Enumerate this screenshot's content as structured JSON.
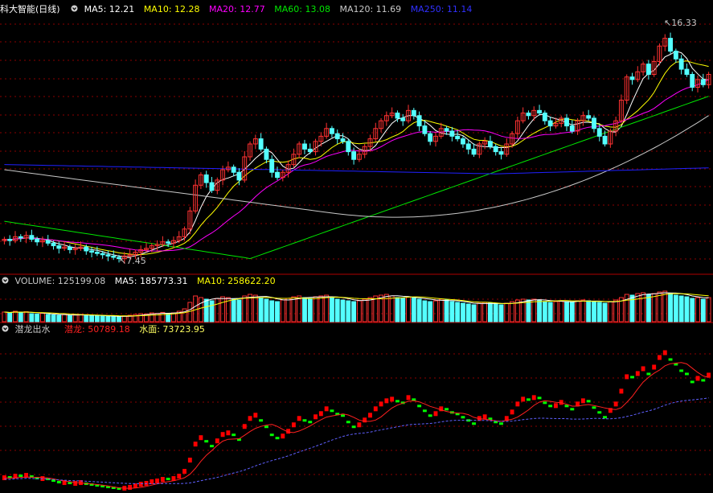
{
  "colors": {
    "up": "#ff3232",
    "down": "#54ffff",
    "grid": "#8b0000",
    "sep": "#b00000",
    "ma5": "#ffffff",
    "ma10": "#ffff00",
    "ma20": "#ff00ff",
    "ma60": "#00e600",
    "ma120": "#c8c8c8",
    "ma250": "#2020ff",
    "qianlong_up": "#ff0000",
    "qianlong_down": "#00ff00",
    "qianlong_line": "#ff2020",
    "shuimian": "#6060ff"
  },
  "price_panel": {
    "title": "科大智能(日线)",
    "ma_labels": [
      {
        "text": "MA5: 12.21",
        "color": "#ffffff"
      },
      {
        "text": "MA10: 12.28",
        "color": "#ffff00"
      },
      {
        "text": "MA20: 12.77",
        "color": "#ff00ff"
      },
      {
        "text": "MA60: 13.08",
        "color": "#00e600"
      },
      {
        "text": "MA120: 11.69",
        "color": "#c8c8c8"
      },
      {
        "text": "MA250: 11.14",
        "color": "#2020ff"
      }
    ],
    "high_label": "16.33",
    "low_label": "7.45"
  },
  "volume_panel": {
    "labels": [
      {
        "text": "VOLUME: 125199.08",
        "color": "#c8c8c8"
      },
      {
        "text": "MA5: 185773.31",
        "color": "#ffffff"
      },
      {
        "text": "MA10: 258622.20",
        "color": "#ffff00"
      }
    ]
  },
  "indicator_panel": {
    "title": "潜龙出水",
    "labels": [
      {
        "text": "潜龙: 50789.18",
        "color": "#ff2020"
      },
      {
        "text": "水面: 73723.95",
        "color": "#ffff60"
      }
    ]
  },
  "chart_data": {
    "type": "candlestick",
    "closes": [
      8.2,
      8.15,
      8.3,
      8.25,
      8.35,
      8.2,
      8.1,
      8.15,
      8.05,
      7.95,
      7.85,
      7.9,
      7.8,
      7.85,
      7.9,
      7.75,
      7.7,
      7.65,
      7.6,
      7.55,
      7.5,
      7.45,
      7.55,
      7.6,
      7.7,
      7.8,
      7.85,
      7.95,
      8.0,
      8.1,
      8.05,
      8.15,
      8.3,
      8.6,
      9.3,
      10.3,
      10.7,
      10.4,
      10.1,
      10.5,
      10.9,
      11.0,
      10.8,
      10.5,
      11.4,
      11.9,
      12.1,
      11.7,
      11.3,
      10.8,
      10.6,
      10.8,
      11.1,
      11.5,
      11.9,
      11.7,
      11.6,
      12.0,
      12.2,
      12.5,
      12.3,
      12.1,
      12.0,
      11.6,
      11.3,
      11.5,
      11.8,
      12.1,
      12.5,
      12.8,
      13.0,
      13.1,
      12.9,
      12.8,
      13.2,
      13.0,
      12.6,
      12.3,
      12.0,
      12.2,
      12.5,
      12.4,
      12.2,
      12.1,
      11.9,
      11.7,
      11.5,
      11.9,
      12.0,
      11.8,
      11.6,
      11.5,
      11.9,
      12.3,
      12.8,
      13.1,
      13.0,
      13.2,
      13.1,
      12.8,
      12.6,
      12.7,
      12.9,
      12.6,
      12.4,
      12.8,
      13.0,
      12.9,
      12.5,
      12.2,
      11.9,
      12.4,
      12.8,
      13.6,
      14.5,
      14.4,
      14.7,
      15.0,
      14.6,
      15.1,
      15.7,
      16.0,
      15.5,
      15.2,
      14.8,
      14.6,
      14.1,
      14.4,
      14.2,
      14.6
    ],
    "ylim": [
      7.0,
      16.8
    ],
    "volume": [
      60,
      55,
      65,
      58,
      62,
      50,
      48,
      52,
      45,
      42,
      40,
      44,
      38,
      42,
      45,
      40,
      38,
      36,
      35,
      33,
      32,
      30,
      36,
      40,
      45,
      50,
      48,
      55,
      52,
      58,
      50,
      55,
      65,
      80,
      120,
      160,
      150,
      140,
      130,
      145,
      155,
      150,
      140,
      135,
      160,
      170,
      165,
      150,
      140,
      130,
      125,
      135,
      145,
      155,
      160,
      150,
      145,
      155,
      160,
      165,
      150,
      140,
      135,
      130,
      125,
      130,
      140,
      150,
      160,
      165,
      170,
      160,
      150,
      145,
      155,
      150,
      140,
      130,
      125,
      130,
      140,
      135,
      125,
      120,
      115,
      110,
      105,
      115,
      120,
      115,
      110,
      105,
      115,
      125,
      135,
      140,
      135,
      140,
      135,
      125,
      120,
      125,
      130,
      125,
      120,
      130,
      135,
      130,
      125,
      120,
      115,
      125,
      135,
      150,
      170,
      165,
      175,
      180,
      170,
      175,
      185,
      190,
      175,
      165,
      160,
      155,
      145,
      150,
      140,
      150
    ],
    "volume_max": 200,
    "qianlong_max": 90000
  }
}
